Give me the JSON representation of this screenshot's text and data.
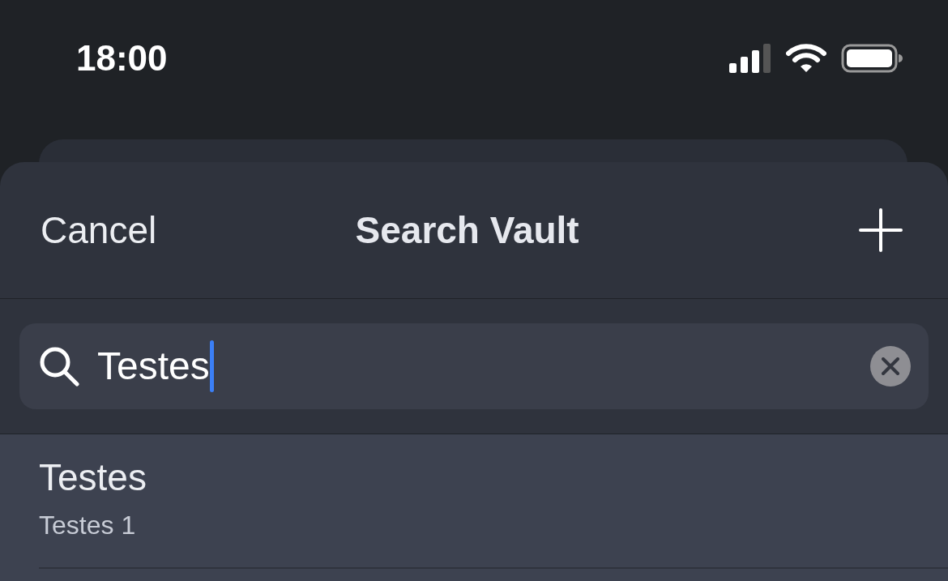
{
  "status_bar": {
    "time": "18:00"
  },
  "header": {
    "cancel": "Cancel",
    "title": "Search Vault"
  },
  "search": {
    "value": "Testes"
  },
  "results": [
    {
      "title": "Testes",
      "subtitle": "Testes 1"
    }
  ]
}
